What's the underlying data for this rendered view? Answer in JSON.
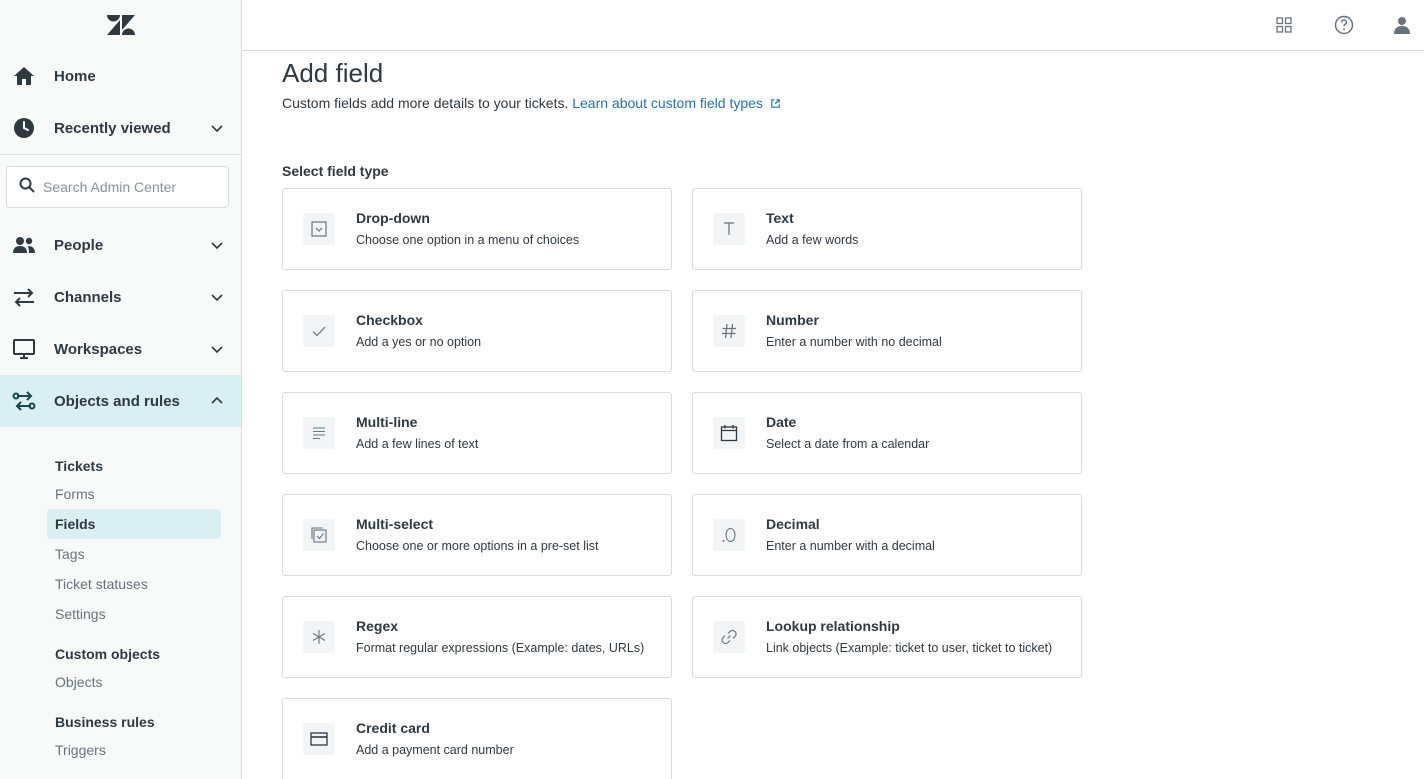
{
  "sidebar": {
    "nav": [
      {
        "label": "Home",
        "icon": "home-icon"
      },
      {
        "label": "Recently viewed",
        "icon": "clock-icon"
      }
    ],
    "search": {
      "placeholder": "Search Admin Center"
    },
    "sections": [
      {
        "label": "People",
        "icon": "people-icon"
      },
      {
        "label": "Channels",
        "icon": "arrows-icon"
      },
      {
        "label": "Workspaces",
        "icon": "monitor-icon"
      },
      {
        "label": "Objects and rules",
        "icon": "rules-icon"
      }
    ],
    "sub": {
      "tickets": {
        "heading": "Tickets",
        "items": [
          "Forms",
          "Fields",
          "Tags",
          "Ticket statuses",
          "Settings"
        ]
      },
      "custom_objects": {
        "heading": "Custom objects",
        "items": [
          "Objects"
        ]
      },
      "business_rules": {
        "heading": "Business rules",
        "items": [
          "Triggers"
        ]
      }
    }
  },
  "main": {
    "title": "Add field",
    "subtitle": "Custom fields add more details to your tickets.",
    "learn_link": "Learn about custom field types",
    "section_label": "Select field type",
    "cards": [
      {
        "title": "Drop-down",
        "desc": "Choose one option in a menu of choices",
        "icon": "dropdown-icon"
      },
      {
        "title": "Text",
        "desc": "Add a few words",
        "icon": "text-icon"
      },
      {
        "title": "Checkbox",
        "desc": "Add a yes or no option",
        "icon": "check-icon"
      },
      {
        "title": "Number",
        "desc": "Enter a number with no decimal",
        "icon": "hash-icon"
      },
      {
        "title": "Multi-line",
        "desc": "Add a few lines of text",
        "icon": "lines-icon"
      },
      {
        "title": "Date",
        "desc": "Select a date from a calendar",
        "icon": "calendar-icon"
      },
      {
        "title": "Multi-select",
        "desc": "Choose one or more options in a pre-set list",
        "icon": "multiselect-icon"
      },
      {
        "title": "Decimal",
        "desc": "Enter a number with a decimal",
        "icon": "decimal-icon"
      },
      {
        "title": "Regex",
        "desc": "Format regular expressions (Example: dates, URLs)",
        "icon": "asterisk-icon"
      },
      {
        "title": "Lookup relationship",
        "desc": "Link objects (Example: ticket to user, ticket to ticket)",
        "icon": "link-icon"
      },
      {
        "title": "Credit card",
        "desc": "Add a payment card number",
        "icon": "credit-card-icon"
      }
    ]
  },
  "colors": {
    "accent": "#1f73b7",
    "active_bg": "#d9eff1",
    "brand_green": "#17494d"
  }
}
